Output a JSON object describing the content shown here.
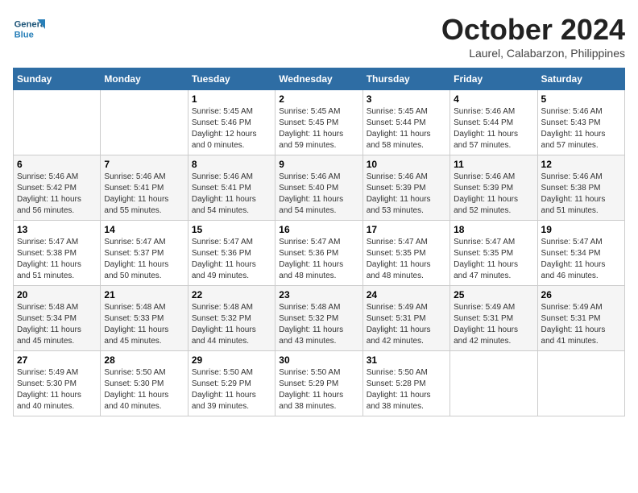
{
  "header": {
    "logo_general": "General",
    "logo_blue": "Blue",
    "month_title": "October 2024",
    "location": "Laurel, Calabarzon, Philippines"
  },
  "weekdays": [
    "Sunday",
    "Monday",
    "Tuesday",
    "Wednesday",
    "Thursday",
    "Friday",
    "Saturday"
  ],
  "weeks": [
    [
      {
        "day": "",
        "info": ""
      },
      {
        "day": "",
        "info": ""
      },
      {
        "day": "1",
        "info": "Sunrise: 5:45 AM\nSunset: 5:46 PM\nDaylight: 12 hours\nand 0 minutes."
      },
      {
        "day": "2",
        "info": "Sunrise: 5:45 AM\nSunset: 5:45 PM\nDaylight: 11 hours\nand 59 minutes."
      },
      {
        "day": "3",
        "info": "Sunrise: 5:45 AM\nSunset: 5:44 PM\nDaylight: 11 hours\nand 58 minutes."
      },
      {
        "day": "4",
        "info": "Sunrise: 5:46 AM\nSunset: 5:44 PM\nDaylight: 11 hours\nand 57 minutes."
      },
      {
        "day": "5",
        "info": "Sunrise: 5:46 AM\nSunset: 5:43 PM\nDaylight: 11 hours\nand 57 minutes."
      }
    ],
    [
      {
        "day": "6",
        "info": "Sunrise: 5:46 AM\nSunset: 5:42 PM\nDaylight: 11 hours\nand 56 minutes."
      },
      {
        "day": "7",
        "info": "Sunrise: 5:46 AM\nSunset: 5:41 PM\nDaylight: 11 hours\nand 55 minutes."
      },
      {
        "day": "8",
        "info": "Sunrise: 5:46 AM\nSunset: 5:41 PM\nDaylight: 11 hours\nand 54 minutes."
      },
      {
        "day": "9",
        "info": "Sunrise: 5:46 AM\nSunset: 5:40 PM\nDaylight: 11 hours\nand 54 minutes."
      },
      {
        "day": "10",
        "info": "Sunrise: 5:46 AM\nSunset: 5:39 PM\nDaylight: 11 hours\nand 53 minutes."
      },
      {
        "day": "11",
        "info": "Sunrise: 5:46 AM\nSunset: 5:39 PM\nDaylight: 11 hours\nand 52 minutes."
      },
      {
        "day": "12",
        "info": "Sunrise: 5:46 AM\nSunset: 5:38 PM\nDaylight: 11 hours\nand 51 minutes."
      }
    ],
    [
      {
        "day": "13",
        "info": "Sunrise: 5:47 AM\nSunset: 5:38 PM\nDaylight: 11 hours\nand 51 minutes."
      },
      {
        "day": "14",
        "info": "Sunrise: 5:47 AM\nSunset: 5:37 PM\nDaylight: 11 hours\nand 50 minutes."
      },
      {
        "day": "15",
        "info": "Sunrise: 5:47 AM\nSunset: 5:36 PM\nDaylight: 11 hours\nand 49 minutes."
      },
      {
        "day": "16",
        "info": "Sunrise: 5:47 AM\nSunset: 5:36 PM\nDaylight: 11 hours\nand 48 minutes."
      },
      {
        "day": "17",
        "info": "Sunrise: 5:47 AM\nSunset: 5:35 PM\nDaylight: 11 hours\nand 48 minutes."
      },
      {
        "day": "18",
        "info": "Sunrise: 5:47 AM\nSunset: 5:35 PM\nDaylight: 11 hours\nand 47 minutes."
      },
      {
        "day": "19",
        "info": "Sunrise: 5:47 AM\nSunset: 5:34 PM\nDaylight: 11 hours\nand 46 minutes."
      }
    ],
    [
      {
        "day": "20",
        "info": "Sunrise: 5:48 AM\nSunset: 5:34 PM\nDaylight: 11 hours\nand 45 minutes."
      },
      {
        "day": "21",
        "info": "Sunrise: 5:48 AM\nSunset: 5:33 PM\nDaylight: 11 hours\nand 45 minutes."
      },
      {
        "day": "22",
        "info": "Sunrise: 5:48 AM\nSunset: 5:32 PM\nDaylight: 11 hours\nand 44 minutes."
      },
      {
        "day": "23",
        "info": "Sunrise: 5:48 AM\nSunset: 5:32 PM\nDaylight: 11 hours\nand 43 minutes."
      },
      {
        "day": "24",
        "info": "Sunrise: 5:49 AM\nSunset: 5:31 PM\nDaylight: 11 hours\nand 42 minutes."
      },
      {
        "day": "25",
        "info": "Sunrise: 5:49 AM\nSunset: 5:31 PM\nDaylight: 11 hours\nand 42 minutes."
      },
      {
        "day": "26",
        "info": "Sunrise: 5:49 AM\nSunset: 5:31 PM\nDaylight: 11 hours\nand 41 minutes."
      }
    ],
    [
      {
        "day": "27",
        "info": "Sunrise: 5:49 AM\nSunset: 5:30 PM\nDaylight: 11 hours\nand 40 minutes."
      },
      {
        "day": "28",
        "info": "Sunrise: 5:50 AM\nSunset: 5:30 PM\nDaylight: 11 hours\nand 40 minutes."
      },
      {
        "day": "29",
        "info": "Sunrise: 5:50 AM\nSunset: 5:29 PM\nDaylight: 11 hours\nand 39 minutes."
      },
      {
        "day": "30",
        "info": "Sunrise: 5:50 AM\nSunset: 5:29 PM\nDaylight: 11 hours\nand 38 minutes."
      },
      {
        "day": "31",
        "info": "Sunrise: 5:50 AM\nSunset: 5:28 PM\nDaylight: 11 hours\nand 38 minutes."
      },
      {
        "day": "",
        "info": ""
      },
      {
        "day": "",
        "info": ""
      }
    ]
  ]
}
